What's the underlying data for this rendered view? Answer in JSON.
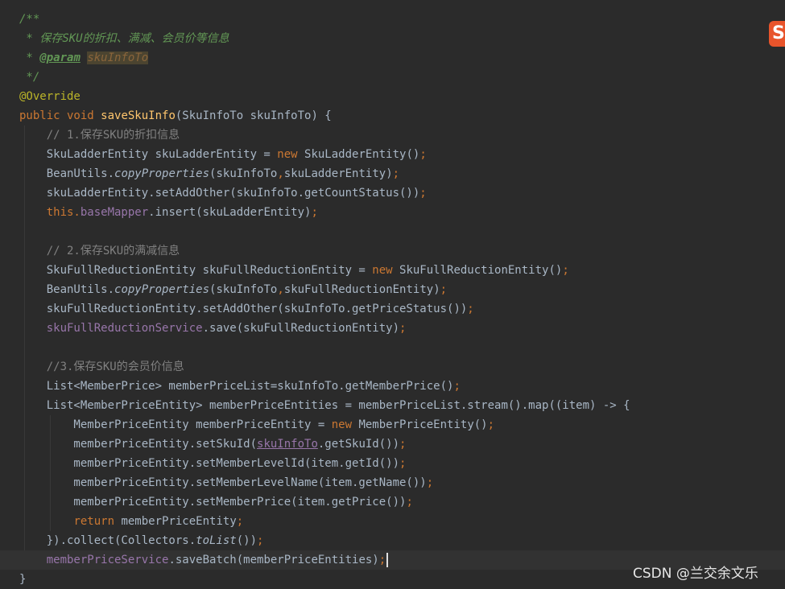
{
  "logo": {
    "letter": "S"
  },
  "watermark": "CSDN @兰交余文乐",
  "code": {
    "l01": "/**",
    "l02": " * 保存SKU的折扣、满减、会员价等信息",
    "l03_star": " * ",
    "l03_tag": "@param",
    "l03_name": "skuInfoTo",
    "l04": " */",
    "l05": "@Override",
    "l06_kw": "public void ",
    "l06_name": "saveSkuInfo",
    "l06_rest": "(SkuInfoTo skuInfoTo) {",
    "l07": "    // 1.保存SKU的折扣信息",
    "l08_a": "    SkuLadderEntity skuLadderEntity = ",
    "l08_new": "new ",
    "l08_b": "SkuLadderEntity()",
    "l08_semi": ";",
    "l09_a": "    BeanUtils.",
    "l09_static": "copyProperties",
    "l09_b": "(skuInfoTo",
    "l09_comma": ",",
    "l09_c": "skuLadderEntity)",
    "l09_semi": ";",
    "l10_a": "    skuLadderEntity.setAddOther(skuInfoTo.getCountStatus())",
    "l10_semi": ";",
    "l11_this": "    this.",
    "l11_field": "baseMapper",
    "l11_b": ".insert(skuLadderEntity)",
    "l11_semi": ";",
    "l12": "",
    "l13": "    // 2.保存SKU的满减信息",
    "l14_a": "    SkuFullReductionEntity skuFullReductionEntity = ",
    "l14_new": "new ",
    "l14_b": "SkuFullReductionEntity()",
    "l14_semi": ";",
    "l15_a": "    BeanUtils.",
    "l15_static": "copyProperties",
    "l15_b": "(skuInfoTo",
    "l15_comma": ",",
    "l15_c": "skuFullReductionEntity)",
    "l15_semi": ";",
    "l16_a": "    skuFullReductionEntity.setAddOther(skuInfoTo.getPriceStatus())",
    "l16_semi": ";",
    "l17_indent": "    ",
    "l17_field": "skuFullReductionService",
    "l17_b": ".save(skuFullReductionEntity)",
    "l17_semi": ";",
    "l18": "",
    "l19": "    //3.保存SKU的会员价信息",
    "l20_a": "    List<MemberPrice> memberPriceList=skuInfoTo.getMemberPrice()",
    "l20_semi": ";",
    "l21": "    List<MemberPriceEntity> memberPriceEntities = memberPriceList.stream().map((item) -> {",
    "l22_a": "        MemberPriceEntity memberPriceEntity = ",
    "l22_new": "new ",
    "l22_b": "MemberPriceEntity()",
    "l22_semi": ";",
    "l23_a": "        memberPriceEntity.setSkuId(",
    "l23_field": "skuInfoTo",
    "l23_b": ".getSkuId())",
    "l23_semi": ";",
    "l24_a": "        memberPriceEntity.setMemberLevelId(item.getId())",
    "l24_semi": ";",
    "l25_a": "        memberPriceEntity.setMemberLevelName(item.getName())",
    "l25_semi": ";",
    "l26_a": "        memberPriceEntity.setMemberPrice(item.getPrice())",
    "l26_semi": ";",
    "l27_indent": "        ",
    "l27_kw": "return ",
    "l27_b": "memberPriceEntity",
    "l27_semi": ";",
    "l28_a": "    }).collect(Collectors.",
    "l28_static": "toList",
    "l28_b": "())",
    "l28_semi": ";",
    "l29_indent": "    ",
    "l29_field": "memberPriceService",
    "l29_b": ".saveBatch(memberPriceEntities)",
    "l29_semi": ";",
    "l30": "}"
  },
  "colors": {
    "background": "#2b2b2b",
    "keyword": "#cc7832",
    "doc_comment": "#629755",
    "line_comment": "#808080",
    "annotation": "#bbb529",
    "method_declaration": "#ffc66d",
    "field": "#9876aa",
    "default_text": "#a9b7c6",
    "logo": "#e8542b"
  }
}
